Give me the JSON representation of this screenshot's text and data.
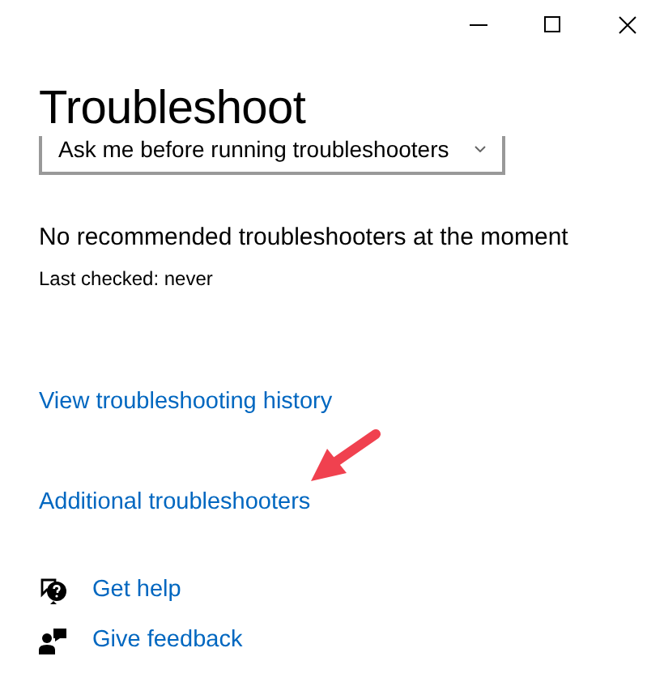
{
  "title": "Troubleshoot",
  "dropdown": {
    "value": "Ask me before running troubleshooters"
  },
  "status": {
    "message": "No recommended troubleshooters at the moment",
    "last_checked": "Last checked: never"
  },
  "links": [
    "View troubleshooting history",
    "Additional troubleshooters"
  ],
  "help_links": [
    {
      "kind": "help",
      "label": "Get help"
    },
    {
      "kind": "feedback",
      "label": "Give feedback"
    }
  ]
}
